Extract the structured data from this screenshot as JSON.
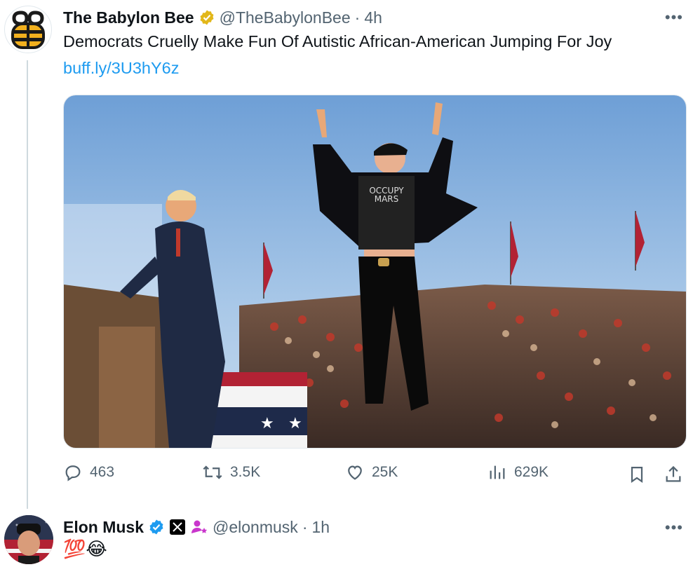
{
  "tweet": {
    "author_name": "The Babylon Bee",
    "author_handle": "@TheBabylonBee",
    "dot": "·",
    "time": "4h",
    "more": "•••",
    "text": "Democrats Cruelly Make Fun Of Autistic African-American Jumping For Joy",
    "link": "buff.ly/3U3hY6z",
    "image_shirt_text_1": "OCCUPY",
    "image_shirt_text_2": "MARS",
    "stats": {
      "replies": "463",
      "retweets": "3.5K",
      "likes": "25K",
      "views": "629K"
    }
  },
  "reply": {
    "author_name": "Elon Musk",
    "author_handle": "@elonmusk",
    "dot": "·",
    "time": "1h",
    "more": "•••",
    "text": "💯😂"
  },
  "colors": {
    "link": "#1d9bf0",
    "verified_gold": "#e2b719",
    "verified_blue": "#1d9bf0",
    "muted": "#536471",
    "affiliate_pink": "#c936cc"
  },
  "icons": [
    "babylon-bee-logo-icon",
    "verified-gold-icon",
    "verified-blue-icon",
    "x-logo-icon",
    "affiliate-badge-icon",
    "reply-icon",
    "retweet-icon",
    "like-icon",
    "views-icon",
    "bookmark-icon",
    "share-icon"
  ]
}
